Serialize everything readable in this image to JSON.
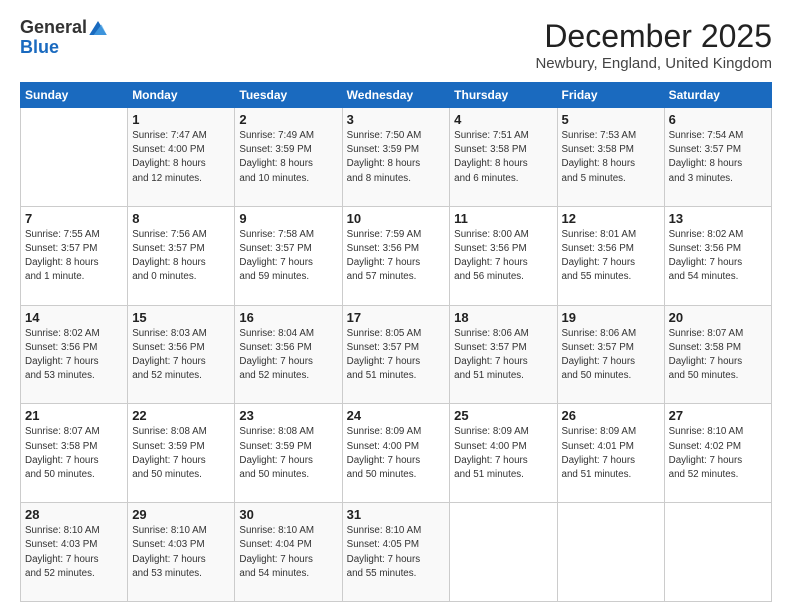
{
  "header": {
    "logo": {
      "general": "General",
      "blue": "Blue"
    },
    "title": "December 2025",
    "location": "Newbury, England, United Kingdom"
  },
  "weekdays": [
    "Sunday",
    "Monday",
    "Tuesday",
    "Wednesday",
    "Thursday",
    "Friday",
    "Saturday"
  ],
  "weeks": [
    [
      {
        "day": "",
        "info": ""
      },
      {
        "day": "1",
        "info": "Sunrise: 7:47 AM\nSunset: 4:00 PM\nDaylight: 8 hours\nand 12 minutes."
      },
      {
        "day": "2",
        "info": "Sunrise: 7:49 AM\nSunset: 3:59 PM\nDaylight: 8 hours\nand 10 minutes."
      },
      {
        "day": "3",
        "info": "Sunrise: 7:50 AM\nSunset: 3:59 PM\nDaylight: 8 hours\nand 8 minutes."
      },
      {
        "day": "4",
        "info": "Sunrise: 7:51 AM\nSunset: 3:58 PM\nDaylight: 8 hours\nand 6 minutes."
      },
      {
        "day": "5",
        "info": "Sunrise: 7:53 AM\nSunset: 3:58 PM\nDaylight: 8 hours\nand 5 minutes."
      },
      {
        "day": "6",
        "info": "Sunrise: 7:54 AM\nSunset: 3:57 PM\nDaylight: 8 hours\nand 3 minutes."
      }
    ],
    [
      {
        "day": "7",
        "info": "Sunrise: 7:55 AM\nSunset: 3:57 PM\nDaylight: 8 hours\nand 1 minute."
      },
      {
        "day": "8",
        "info": "Sunrise: 7:56 AM\nSunset: 3:57 PM\nDaylight: 8 hours\nand 0 minutes."
      },
      {
        "day": "9",
        "info": "Sunrise: 7:58 AM\nSunset: 3:57 PM\nDaylight: 7 hours\nand 59 minutes."
      },
      {
        "day": "10",
        "info": "Sunrise: 7:59 AM\nSunset: 3:56 PM\nDaylight: 7 hours\nand 57 minutes."
      },
      {
        "day": "11",
        "info": "Sunrise: 8:00 AM\nSunset: 3:56 PM\nDaylight: 7 hours\nand 56 minutes."
      },
      {
        "day": "12",
        "info": "Sunrise: 8:01 AM\nSunset: 3:56 PM\nDaylight: 7 hours\nand 55 minutes."
      },
      {
        "day": "13",
        "info": "Sunrise: 8:02 AM\nSunset: 3:56 PM\nDaylight: 7 hours\nand 54 minutes."
      }
    ],
    [
      {
        "day": "14",
        "info": "Sunrise: 8:02 AM\nSunset: 3:56 PM\nDaylight: 7 hours\nand 53 minutes."
      },
      {
        "day": "15",
        "info": "Sunrise: 8:03 AM\nSunset: 3:56 PM\nDaylight: 7 hours\nand 52 minutes."
      },
      {
        "day": "16",
        "info": "Sunrise: 8:04 AM\nSunset: 3:56 PM\nDaylight: 7 hours\nand 52 minutes."
      },
      {
        "day": "17",
        "info": "Sunrise: 8:05 AM\nSunset: 3:57 PM\nDaylight: 7 hours\nand 51 minutes."
      },
      {
        "day": "18",
        "info": "Sunrise: 8:06 AM\nSunset: 3:57 PM\nDaylight: 7 hours\nand 51 minutes."
      },
      {
        "day": "19",
        "info": "Sunrise: 8:06 AM\nSunset: 3:57 PM\nDaylight: 7 hours\nand 50 minutes."
      },
      {
        "day": "20",
        "info": "Sunrise: 8:07 AM\nSunset: 3:58 PM\nDaylight: 7 hours\nand 50 minutes."
      }
    ],
    [
      {
        "day": "21",
        "info": "Sunrise: 8:07 AM\nSunset: 3:58 PM\nDaylight: 7 hours\nand 50 minutes."
      },
      {
        "day": "22",
        "info": "Sunrise: 8:08 AM\nSunset: 3:59 PM\nDaylight: 7 hours\nand 50 minutes."
      },
      {
        "day": "23",
        "info": "Sunrise: 8:08 AM\nSunset: 3:59 PM\nDaylight: 7 hours\nand 50 minutes."
      },
      {
        "day": "24",
        "info": "Sunrise: 8:09 AM\nSunset: 4:00 PM\nDaylight: 7 hours\nand 50 minutes."
      },
      {
        "day": "25",
        "info": "Sunrise: 8:09 AM\nSunset: 4:00 PM\nDaylight: 7 hours\nand 51 minutes."
      },
      {
        "day": "26",
        "info": "Sunrise: 8:09 AM\nSunset: 4:01 PM\nDaylight: 7 hours\nand 51 minutes."
      },
      {
        "day": "27",
        "info": "Sunrise: 8:10 AM\nSunset: 4:02 PM\nDaylight: 7 hours\nand 52 minutes."
      }
    ],
    [
      {
        "day": "28",
        "info": "Sunrise: 8:10 AM\nSunset: 4:03 PM\nDaylight: 7 hours\nand 52 minutes."
      },
      {
        "day": "29",
        "info": "Sunrise: 8:10 AM\nSunset: 4:03 PM\nDaylight: 7 hours\nand 53 minutes."
      },
      {
        "day": "30",
        "info": "Sunrise: 8:10 AM\nSunset: 4:04 PM\nDaylight: 7 hours\nand 54 minutes."
      },
      {
        "day": "31",
        "info": "Sunrise: 8:10 AM\nSunset: 4:05 PM\nDaylight: 7 hours\nand 55 minutes."
      },
      {
        "day": "",
        "info": ""
      },
      {
        "day": "",
        "info": ""
      },
      {
        "day": "",
        "info": ""
      }
    ]
  ]
}
